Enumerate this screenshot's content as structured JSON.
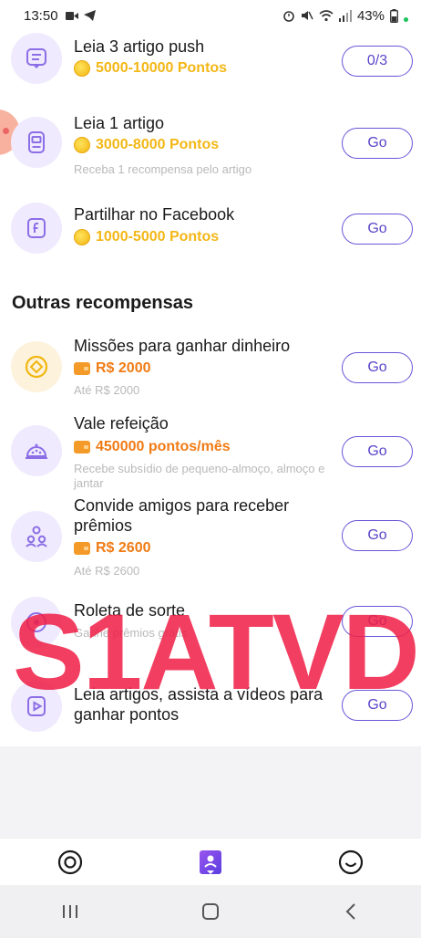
{
  "status_bar": {
    "time": "13:50",
    "battery": "43%"
  },
  "tasks": [
    {
      "title": "Leia 3 artigo push",
      "reward": "5000-10000 Pontos",
      "subtitle": "",
      "button": "0/3"
    },
    {
      "title": "Leia 1 artigo",
      "reward": "3000-8000 Pontos",
      "subtitle": "Receba 1 recompensa pelo artigo",
      "button": "Go"
    },
    {
      "title": "Partilhar no Facebook",
      "reward": "1000-5000 Pontos",
      "subtitle": "",
      "button": "Go"
    }
  ],
  "section": {
    "title": "Outras recompensas"
  },
  "other_rewards": [
    {
      "title": "Missões para ganhar dinheiro",
      "reward": "R$ 2000",
      "subtitle": "Até R$ 2000",
      "button": "Go"
    },
    {
      "title": "Vale refeição",
      "reward": "450000 pontos/mês",
      "subtitle": "Recebe subsídio de pequeno-almoço, almoço e jantar",
      "button": "Go"
    },
    {
      "title": "Convide amigos para receber prêmios",
      "reward": "R$ 2600",
      "subtitle": "Até R$ 2600",
      "button": "Go"
    },
    {
      "title": "Roleta de sorte",
      "reward": "",
      "subtitle": "Ganhe prêmios grátis",
      "button": "Go"
    },
    {
      "title": "Leia artigos, assista a vídeos para ganhar pontos",
      "reward": "",
      "subtitle": "",
      "button": "Go"
    }
  ],
  "watermark": "S1ATVD",
  "bottom_nav": {
    "items": [
      "home-icon",
      "tasks-icon",
      "profile-icon"
    ]
  },
  "colors": {
    "accent": "#6b54d8",
    "coin_yellow": "#f3b716",
    "reward_orange": "#f07b14"
  }
}
